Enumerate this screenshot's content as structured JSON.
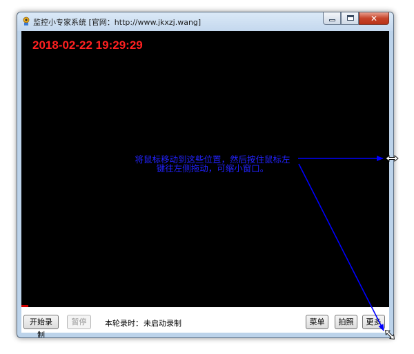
{
  "window": {
    "title": "监控小专家系统 [官网：http://www.jkxzj.wang]",
    "close_symbol": "✕"
  },
  "video": {
    "timestamp": "2018-02-22 19:29:29",
    "hint_line1": "将鼠标移动到这些位置，然后按住鼠标左",
    "hint_line2": "键往左侧拖动，可缩小窗口。"
  },
  "toolbar": {
    "start_record_label": "开始录制",
    "pause_label": "暂停",
    "record_time_label": "本轮录时：",
    "record_status": "未启动录制",
    "menu_label": "菜单",
    "snapshot_label": "拍照",
    "more_label": "更多"
  },
  "colors": {
    "timestamp": "#ff2020",
    "hint_text": "#2222ff",
    "arrow": "#0000ff"
  },
  "icons": {
    "app": "camera-app-icon",
    "minimize": "minimize-icon",
    "maximize": "maximize-icon",
    "close": "close-icon",
    "resize_horizontal": "resize-horizontal-cursor-icon",
    "resize_diagonal": "resize-diagonal-cursor-icon"
  }
}
